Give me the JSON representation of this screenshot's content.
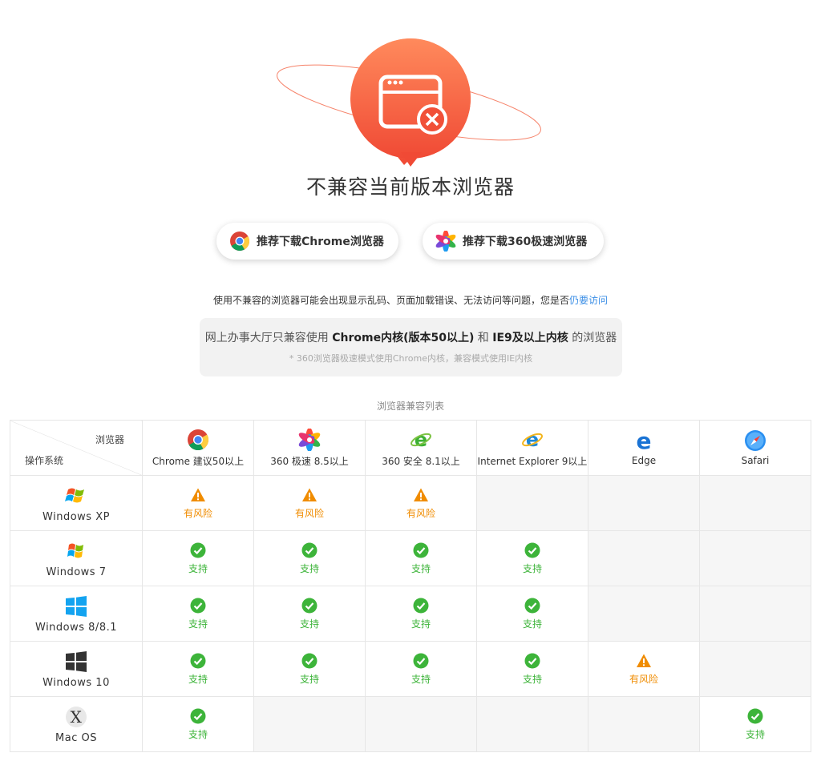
{
  "title": "不兼容当前版本浏览器",
  "buttons": {
    "chrome": "推荐下载Chrome浏览器",
    "b360": "推荐下载360极速浏览器"
  },
  "warning": {
    "text": "使用不兼容的浏览器可能会出现显示乱码、页面加载错误、无法访问等问题，您是否",
    "link": "仍要访问"
  },
  "notice": {
    "p1": "网上办事大厅只兼容使用 ",
    "b1": "Chrome内核(版本50以上)",
    "p2": " 和 ",
    "b2": "IE9及以上内核",
    "p3": " 的浏览器",
    "sub": "* 360浏览器极速模式使用Chrome内核，兼容模式使用IE内核"
  },
  "table": {
    "caption": "浏览器兼容列表",
    "corner_browser": "浏览器",
    "corner_os": "操作系统",
    "browsers": [
      {
        "label": "Chrome  建议50以上",
        "icon": "chrome-icon"
      },
      {
        "label": "360 极速  8.5以上",
        "icon": "360-speed-icon"
      },
      {
        "label": "360 安全  8.1以上",
        "icon": "360-safe-icon"
      },
      {
        "label": "Internet Explorer  9以上",
        "icon": "ie-icon"
      },
      {
        "label": "Edge",
        "icon": "edge-icon"
      },
      {
        "label": "Safari",
        "icon": "safari-icon"
      }
    ],
    "status_labels": {
      "ok": "支持",
      "risk": "有风险"
    },
    "rows": [
      {
        "os": "Windows XP",
        "icon": "windows-xp-icon",
        "cells": [
          "risk",
          "risk",
          "risk",
          "",
          "",
          ""
        ]
      },
      {
        "os": "Windows 7",
        "icon": "windows-7-icon",
        "cells": [
          "ok",
          "ok",
          "ok",
          "ok",
          "",
          ""
        ]
      },
      {
        "os": "Windows 8/8.1",
        "icon": "windows-8-icon",
        "cells": [
          "ok",
          "ok",
          "ok",
          "ok",
          "",
          ""
        ]
      },
      {
        "os": "Windows 10",
        "icon": "windows-10-icon",
        "cells": [
          "ok",
          "ok",
          "ok",
          "ok",
          "risk",
          ""
        ]
      },
      {
        "os": "Mac OS",
        "icon": "mac-os-icon",
        "cells": [
          "ok",
          "",
          "",
          "",
          "",
          "ok"
        ]
      }
    ]
  },
  "colors": {
    "accent": "#f2603c",
    "ok": "#3db43a",
    "risk": "#f08c00",
    "link": "#3a8ee6"
  }
}
